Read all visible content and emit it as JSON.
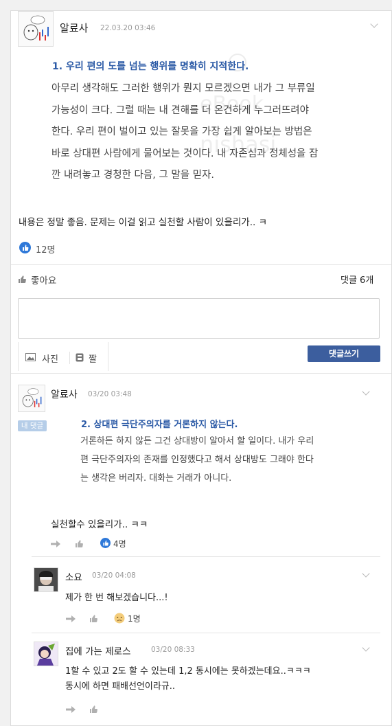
{
  "post": {
    "author": "알료사",
    "timestamp": "22.03.20 03:46",
    "quote_title": "1. 우리 편의 도를 넘는 행위를 명확히 지적한다.",
    "quote_lines": [
      "아무리 생각해도 그러한 행위가 뭔지 모르겠으면 내가 그 부류일",
      "가능성이 크다. 그럴 때는 내 견해를 더 온건하게 누그러뜨려야",
      "한다. 우리 편이 벌이고 있는 잘못을 가장 쉽게 알아보는 방법은",
      "바로 상대편 사람에게 물어보는 것이다. 내 자존심과 정체성을 잠",
      "깐 내려놓고 경청한 다음, 그 말을 믿자."
    ],
    "body": "내용은 정말 좋음. 문제는 이걸 읽고 실천할 사람이 있을리가.. ㅋ",
    "like_count": "12명",
    "like_button": "좋아요",
    "comment_count": "댓글 6개"
  },
  "composer": {
    "placeholder": "",
    "photo_label": "사진",
    "clip_label": "짤",
    "submit_label": "댓글쓰기"
  },
  "comments": [
    {
      "author": "알료사",
      "timestamp": "03/20 03:48",
      "badge": "내 댓글",
      "quote_title": "2. 상대편 극단주의자를 거론하지 않는다.",
      "quote_lines": [
        "거론하든 하지 않든 그건 상대방이 알아서 할 일이다. 내가 우리",
        "편 극단주의자의 존재를 인정했다고 해서 상대방도 그래야 한다",
        "는 생각은 버리자. 대화는 거래가 아니다."
      ],
      "body": "실천할수 있을리가.. ㅋㅋ",
      "reaction_count": "4명"
    }
  ],
  "replies": [
    {
      "author": "소요",
      "timestamp": "03/20 04:08",
      "body": "제가 한 번 해보겠습니다...!",
      "reaction_count": "1명"
    },
    {
      "author": "집에 가는 제로스",
      "timestamp": "03/20 08:33",
      "body_lines": [
        "1할 수 있고 2도 할 수 있는데 1,2 동시에는 못하겠는데요..ㅋㅋㅋ",
        "동시에 하면 패배선언이라규.."
      ]
    }
  ],
  "colors": {
    "accent_blue": "#2b5aa6",
    "button_blue": "#3c5e9e",
    "like_blue": "#2f79d9",
    "badge_bg": "#b5cde8"
  }
}
